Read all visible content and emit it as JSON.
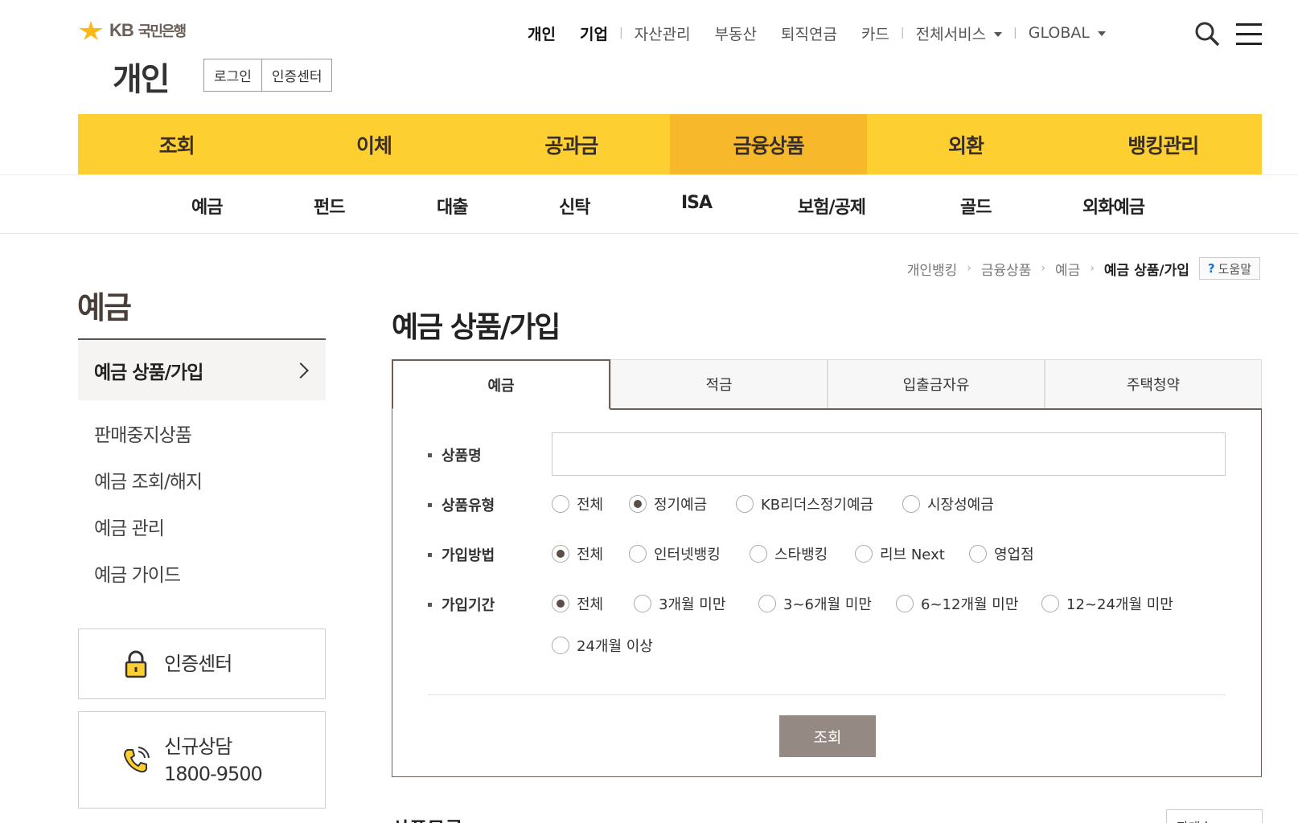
{
  "header": {
    "logo_text": "KB",
    "logo_bank": "국민은행",
    "section_title": "개인",
    "login_label": "로그인",
    "cert_label": "인증센터",
    "top_menu": {
      "personal": "개인",
      "corporate": "기업",
      "asset": "자산관리",
      "realestate": "부동산",
      "pension": "퇴직연금",
      "card": "카드",
      "all_services": "전체서비스",
      "global": "GLOBAL"
    }
  },
  "gnb": [
    "조회",
    "이체",
    "공과금",
    "금융상품",
    "외환",
    "뱅킹관리"
  ],
  "sub_gnb": [
    "예금",
    "펀드",
    "대출",
    "신탁",
    "ISA",
    "보험/공제",
    "골드",
    "외화예금"
  ],
  "breadcrumb": {
    "items": [
      "개인뱅킹",
      "금융상품",
      "예금",
      "예금 상품/가입"
    ],
    "help": "도움말"
  },
  "lnb": {
    "title": "예금",
    "active": "예금 상품/가입",
    "items": [
      "판매중지상품",
      "예금 조회/해지",
      "예금 관리",
      "예금 가이드"
    ],
    "cert_box": "인증센터",
    "call_title": "신규상담",
    "call_number": "1800-9500"
  },
  "main": {
    "title": "예금 상품/가입",
    "tabs": [
      "예금",
      "적금",
      "입출금자유",
      "주택청약"
    ],
    "form": {
      "name_label": "상품명",
      "name_value": "",
      "type_label": "상품유형",
      "type_options": [
        "전체",
        "정기예금",
        "KB리더스정기예금",
        "시장성예금"
      ],
      "type_selected": "정기예금",
      "method_label": "가입방법",
      "method_options": [
        "전체",
        "인터넷뱅킹",
        "스타뱅킹",
        "리브 Next",
        "영업점"
      ],
      "method_selected": "전체",
      "period_label": "가입기간",
      "period_options": [
        "전체",
        "3개월 미만",
        "3~6개월 미만",
        "6~12개월 미만",
        "12~24개월 미만",
        "24개월 이상"
      ],
      "period_selected": "전체",
      "search_button": "조회"
    },
    "result_title": "상품목록",
    "sort_label": "판매순"
  }
}
